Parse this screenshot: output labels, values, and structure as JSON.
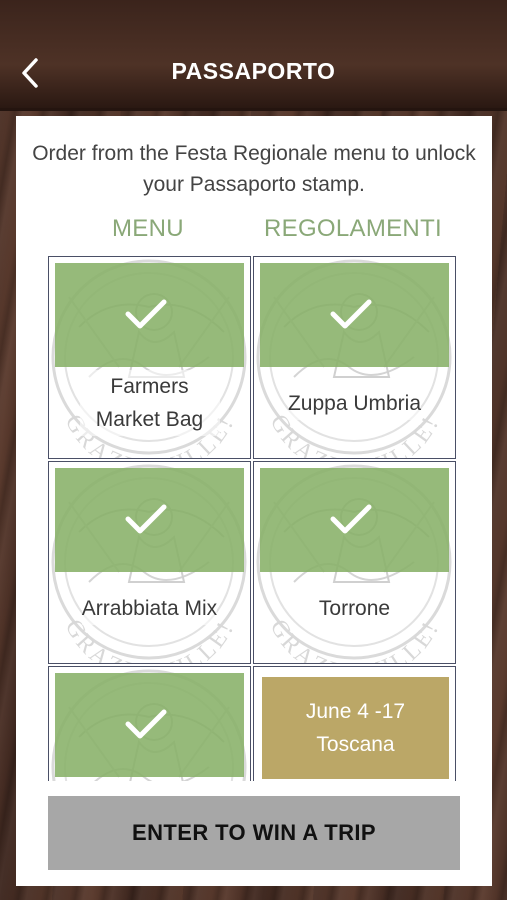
{
  "header": {
    "title": "PASSAPORTO",
    "back_icon": "chevron-left-icon"
  },
  "instructions": "Order from the Festa Regionale menu to unlock your Passaporto stamp.",
  "tabs": [
    {
      "label": "MENU",
      "active": true
    },
    {
      "label": "REGOLAMENTI",
      "active": false
    }
  ],
  "stamp_watermark": "GRAZIE MILLE!",
  "stamps": [
    {
      "label": "Farmers Market Bag",
      "completed": true
    },
    {
      "label": "Zuppa Umbria",
      "completed": true
    },
    {
      "label": "Arrabbiata Mix",
      "completed": true
    },
    {
      "label": "Torrone",
      "completed": true
    },
    {
      "label": "",
      "completed": true
    }
  ],
  "promo": {
    "line1": "June 4 -17",
    "line2": "Toscana"
  },
  "enter_button": {
    "label": "ENTER TO WIN A TRIP"
  },
  "colors": {
    "stamp_green": "#88b068",
    "tab_green": "#8aa878",
    "promo_gold": "#bba767",
    "button_gray": "#a7a7a7"
  }
}
